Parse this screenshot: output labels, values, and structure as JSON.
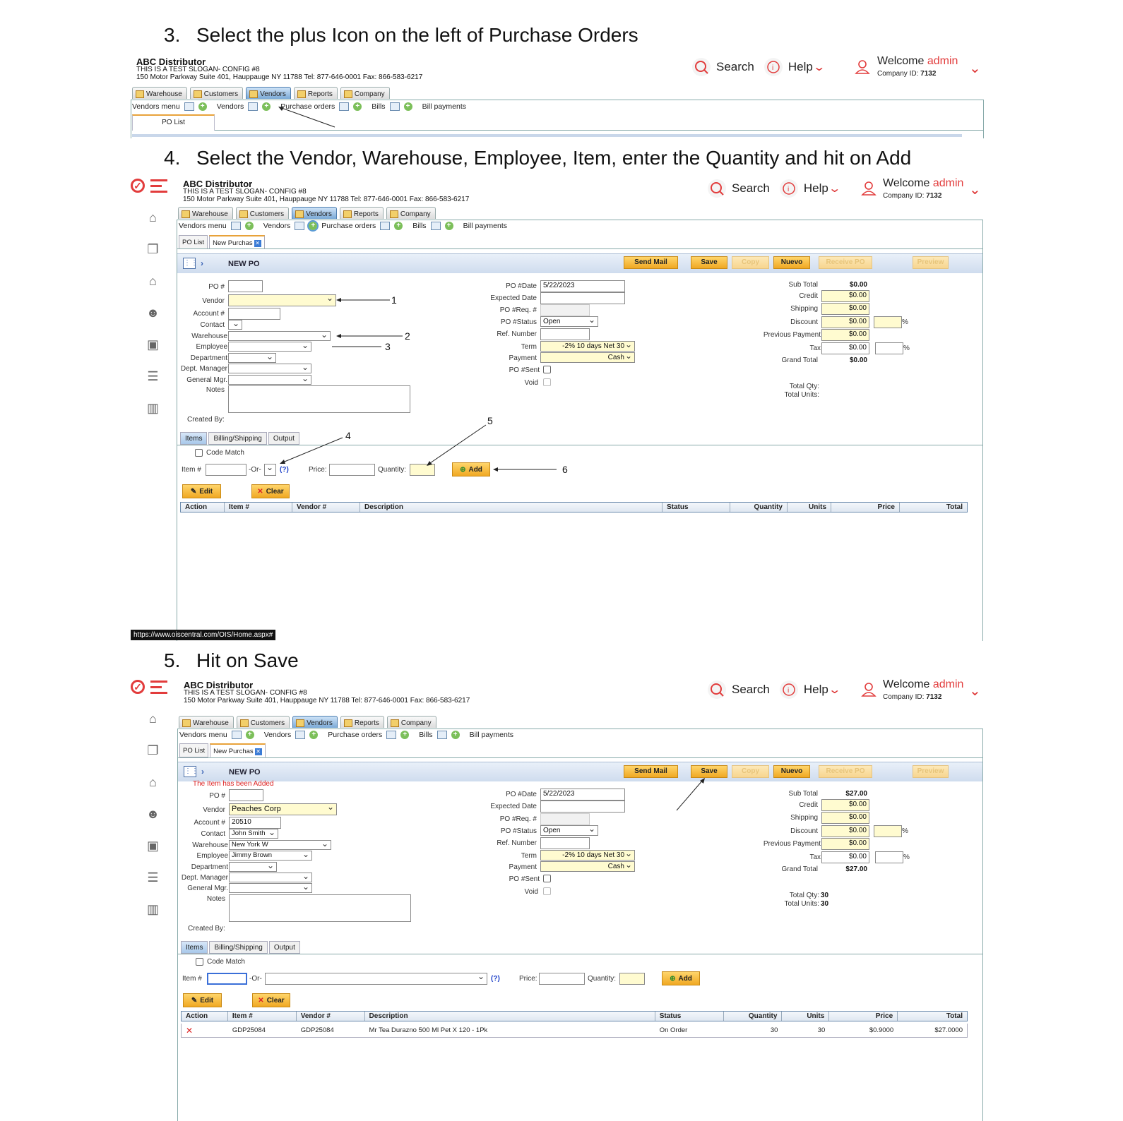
{
  "steps": [
    "3.",
    "Select the plus Icon on the left of Purchase Orders",
    "4.",
    "Select the Vendor, Warehouse, Employee, Item, enter the Quantity and hit on Add",
    "5.",
    "Hit on Save"
  ],
  "company": {
    "name": "ABC Distributor",
    "slogan": "THIS IS A TEST SLOGAN- CONFIG #8",
    "address": "150 Motor Parkway Suite 401, Hauppauge NY 11788 Tel: 877-646-0001 Fax: 866-583-6217"
  },
  "header": {
    "search": "Search",
    "help": "Help",
    "welcome": "Welcome",
    "user": "admin",
    "company_id_label": "Company ID:",
    "company_id": "7132"
  },
  "main_tabs": [
    "Warehouse",
    "Customers",
    "Vendors",
    "Reports",
    "Company"
  ],
  "sub_menu": {
    "vendors_menu": "Vendors menu",
    "vendors": "Vendors",
    "purchase_orders": "Purchase orders",
    "bills": "Bills",
    "bill_payments": "Bill payments"
  },
  "po_tabs": {
    "list": "PO List",
    "new": "New Purchas"
  },
  "toolbar": {
    "title": "NEW PO",
    "send_mail": "Send Mail",
    "save": "Save",
    "copy": "Copy",
    "nuevo": "Nuevo",
    "receive": "Receive PO",
    "preview": "Preview"
  },
  "labels": {
    "po": "PO #",
    "vendor": "Vendor",
    "account": "Account #",
    "contact": "Contact",
    "warehouse": "Warehouse",
    "employee": "Employee",
    "department": "Department",
    "dept_manager": "Dept. Manager",
    "general_mgr": "General Mgr.",
    "notes": "Notes",
    "created_by": "Created By:",
    "po_date": "PO #Date",
    "expected_date": "Expected Date",
    "po_req": "PO #Req. #",
    "po_status": "PO #Status",
    "ref_number": "Ref. Number",
    "term": "Term",
    "payment": "Payment",
    "po_sent": "PO #Sent",
    "void": "Void",
    "sub_total": "Sub Total",
    "credit": "Credit",
    "shipping": "Shipping",
    "discount": "Discount",
    "previous_payment": "Previous Payment",
    "tax": "Tax",
    "grand_total": "Grand Total",
    "total_qty": "Total Qty:",
    "total_units": "Total Units:",
    "pct": "%",
    "code_match": "Code Match",
    "item_no": "Item #",
    "or": "-Or-",
    "help_q": "(?)",
    "price": "Price:",
    "quantity": "Quantity:",
    "add": "Add",
    "edit": "Edit",
    "clear": "Clear"
  },
  "item_tabs": [
    "Items",
    "Billing/Shipping",
    "Output"
  ],
  "table_headers": [
    "Action",
    "Item #",
    "Vendor #",
    "Description",
    "Status",
    "Quantity",
    "Units",
    "Price",
    "Total"
  ],
  "form4": {
    "po_date": "5/22/2023",
    "status": "Open",
    "term": "-2% 10 days Net 30",
    "payment": "Cash",
    "sub_total": "$0.00",
    "credit": "$0.00",
    "shipping": "$0.00",
    "discount": "$0.00",
    "previous_payment": "$0.00",
    "tax": "$0.00",
    "grand_total": "$0.00"
  },
  "form5": {
    "message": "The Item has been Added",
    "vendor": "Peaches Corp",
    "account": "20510",
    "contact": "John Smith",
    "warehouse": "New York W",
    "employee": "Jimmy Brown",
    "po_date": "5/22/2023",
    "status": "Open",
    "term": "-2% 10 days Net 30",
    "payment": "Cash",
    "sub_total": "$27.00",
    "credit": "$0.00",
    "shipping": "$0.00",
    "discount": "$0.00",
    "previous_payment": "$0.00",
    "tax": "$0.00",
    "grand_total": "$27.00",
    "total_qty": "30",
    "total_units": "30"
  },
  "row5": {
    "action": "✕",
    "item": "GDP25084",
    "vendor": "GDP25084",
    "description": "Mr Tea Durazno 500 Ml Pet X 120 - 1Pk",
    "status": "On Order",
    "quantity": "30",
    "units": "30",
    "price": "$0.9000",
    "total": "$27.0000"
  },
  "annotations": [
    "1",
    "2",
    "3",
    "4",
    "5",
    "6"
  ],
  "status_url": "https://www.oiscentral.com/OIS/Home.aspx#"
}
